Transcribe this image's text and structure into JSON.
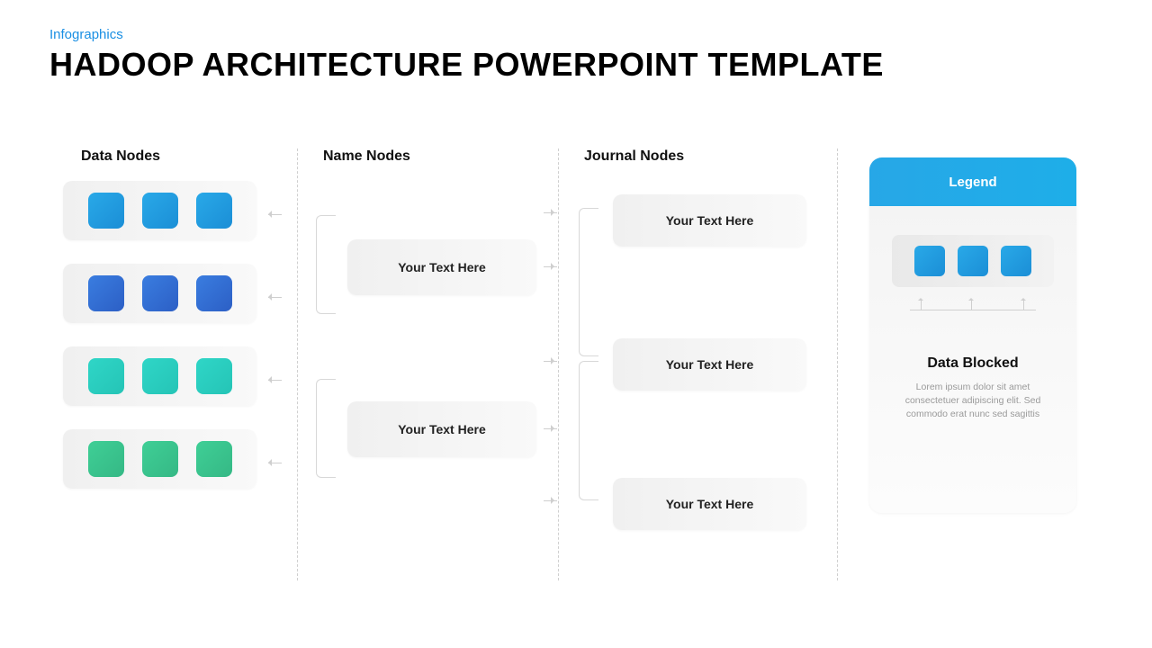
{
  "header": {
    "overline": "Infographics",
    "title": "HADOOP ARCHITECTURE POWERPOINT TEMPLATE"
  },
  "columns": {
    "data": {
      "title": "Data Nodes"
    },
    "name": {
      "title": "Name Nodes",
      "card1": "Your Text Here",
      "card2": "Your Text Here"
    },
    "journal": {
      "title": "Journal  Nodes",
      "card1": "Your Text Here",
      "card2": "Your Text Here",
      "card3": "Your Text Here"
    }
  },
  "legend": {
    "header": "Legend",
    "title": "Data Blocked",
    "body": "Lorem ipsum dolor sit amet consectetuer adipiscing elit. Sed commodo erat nunc sed sagittis"
  },
  "colors": {
    "row1": "#29a9e8",
    "row2": "#3a7de0",
    "row3": "#2fd6c7",
    "row4": "#3fcf96",
    "accent": "#1a8fe3"
  }
}
